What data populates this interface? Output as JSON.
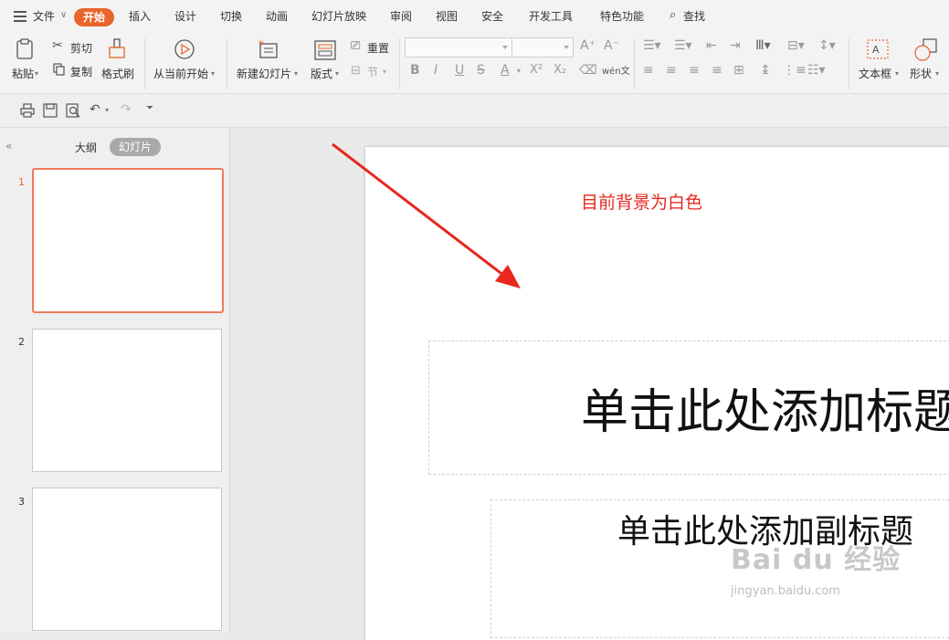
{
  "menu": {
    "file": "文件",
    "tabs": [
      "开始",
      "插入",
      "设计",
      "切换",
      "动画",
      "幻灯片放映",
      "审阅",
      "视图",
      "安全",
      "开发工具",
      "特色功能"
    ],
    "search": "查找"
  },
  "ribbon": {
    "paste": "粘贴",
    "cut": "剪切",
    "copy": "复制",
    "format_painter": "格式刷",
    "from_current": "从当前开始",
    "new_slide": "新建幻灯片",
    "layout": "版式",
    "reset": "重置",
    "section": "节",
    "font_name": "",
    "font_size": "",
    "bold": "B",
    "italic": "I",
    "underline": "U",
    "strike": "S",
    "font_color": "A",
    "superscript": "X²",
    "subscript": "X₂",
    "pinyin": "wén文",
    "text_box": "文本框",
    "shapes": "形状"
  },
  "left_panel": {
    "tab_outline": "大纲",
    "tab_slides": "幻灯片",
    "slides": [
      {
        "number": "1",
        "selected": true
      },
      {
        "number": "2",
        "selected": false
      },
      {
        "number": "3",
        "selected": false
      }
    ]
  },
  "slide": {
    "annotation": "目前背景为白色",
    "title_placeholder": "单击此处添加标题",
    "subtitle_placeholder": "单击此处添加副标题"
  },
  "watermark": {
    "logo": "Bai du 经验",
    "url": "jingyan.baidu.com"
  },
  "colors": {
    "accent": "#e9652b",
    "annotation": "#e8271e",
    "arrow": "#e8271e",
    "selected_thumb_border": "#f07a5c"
  },
  "icons": [
    "hamburger-icon",
    "dropdown-icon",
    "search-icon",
    "paste-icon",
    "scissors-icon",
    "copy-icon",
    "brush-icon",
    "play-icon",
    "new-slide-icon",
    "layout-icon",
    "reset-icon",
    "section-icon",
    "print-icon",
    "save-icon",
    "preview-icon",
    "undo-icon",
    "redo-icon",
    "customize-icon",
    "collapse-icon",
    "arrow-annotation"
  ]
}
